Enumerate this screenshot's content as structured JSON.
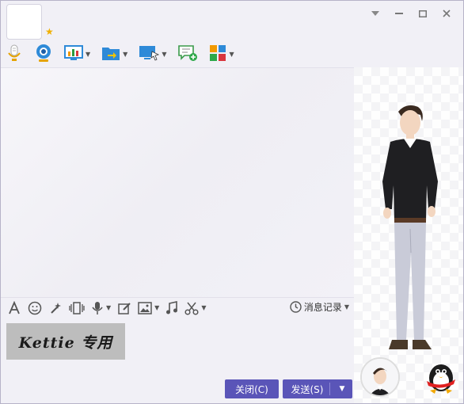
{
  "toolbar": {
    "items": [
      {
        "name": "microphone-icon",
        "has_arrow": false
      },
      {
        "name": "webcam-icon",
        "has_arrow": false
      },
      {
        "name": "screen-share-icon",
        "has_arrow": true
      },
      {
        "name": "file-transfer-icon",
        "has_arrow": true
      },
      {
        "name": "remote-desktop-icon",
        "has_arrow": true
      },
      {
        "name": "new-chat-icon",
        "has_arrow": false
      },
      {
        "name": "apps-grid-icon",
        "has_arrow": true
      }
    ]
  },
  "input_toolbar": {
    "history_label": "消息记录"
  },
  "input": {
    "signature_text": "Kettie 专用"
  },
  "buttons": {
    "close_label": "关闭(C)",
    "send_label": "发送(S)"
  },
  "colors": {
    "accent": "#5a55b8",
    "background": "#f1f0f6"
  }
}
